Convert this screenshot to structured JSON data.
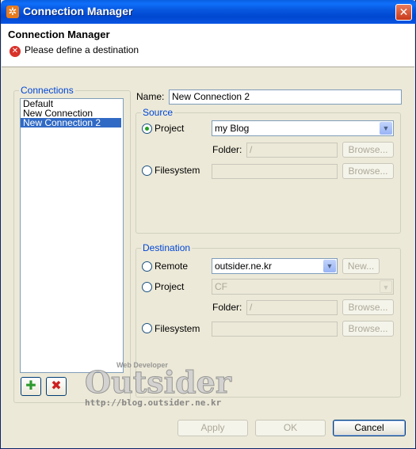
{
  "window": {
    "title": "Connection Manager"
  },
  "header": {
    "title": "Connection Manager",
    "message": "Please define a destination"
  },
  "connections": {
    "legend": "Connections",
    "items": [
      {
        "label": "Default",
        "selected": false
      },
      {
        "label": "New Connection",
        "selected": false
      },
      {
        "label": "New Connection 2",
        "selected": true
      }
    ],
    "add_icon": "plus-icon",
    "remove_icon": "delete-icon"
  },
  "name": {
    "label": "Name:",
    "value": "New Connection 2"
  },
  "source": {
    "legend": "Source",
    "project_label": "Project",
    "project_value": "my Blog",
    "folder_label": "Folder:",
    "folder_value": "/",
    "browse_folder": "Browse...",
    "filesystem_label": "Filesystem",
    "filesystem_value": "",
    "browse_filesystem": "Browse...",
    "selected": "project"
  },
  "destination": {
    "legend": "Destination",
    "remote_label": "Remote",
    "remote_value": "outsider.ne.kr",
    "new_button": "New...",
    "project_label": "Project",
    "project_value": "CF",
    "folder_label": "Folder:",
    "folder_value": "/",
    "browse_folder": "Browse...",
    "filesystem_label": "Filesystem",
    "filesystem_value": "",
    "browse_filesystem": "Browse...",
    "selected": "none"
  },
  "footer": {
    "apply": "Apply",
    "ok": "OK",
    "cancel": "Cancel"
  },
  "watermark": {
    "brand": "Outsider",
    "tag": "Web Developer",
    "url": "http://blog.outsider.ne.kr"
  },
  "colors": {
    "title_bar": "#0a55e3",
    "legend": "#0046d5",
    "selection": "#316ac5",
    "error": "#d8322a"
  }
}
